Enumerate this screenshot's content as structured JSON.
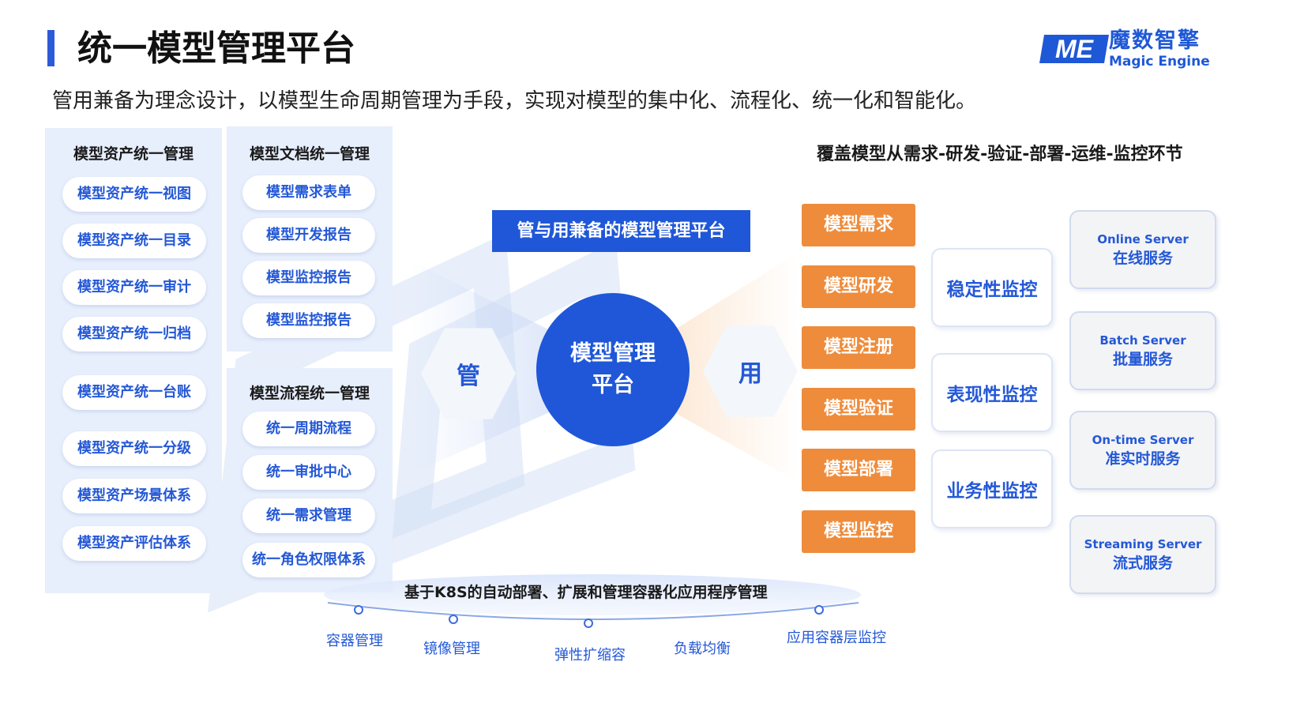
{
  "header": {
    "title": "统一模型管理平台",
    "subtitle": "管用兼备为理念设计，以模型生命周期管理为手段，实现对模型的集中化、流程化、统一化和智能化。"
  },
  "logo": {
    "mark": "ME",
    "name_cn": "魔数智擎",
    "name_en": "Magic Engine"
  },
  "asset_panel": {
    "title": "模型资产统一管理",
    "items": [
      "模型资产统一视图",
      "模型资产统一目录",
      "模型资产统一审计",
      "模型资产统一归档",
      "模型资产统一台账",
      "模型资产统一分级",
      "模型资产场景体系",
      "模型资产评估体系"
    ]
  },
  "doc_panel": {
    "title": "模型文档统一管理",
    "items": [
      "模型需求表单",
      "模型开发报告",
      "模型监控报告",
      "模型监控报告"
    ]
  },
  "flow_panel": {
    "title": "模型流程统一管理",
    "items": [
      "统一周期流程",
      "统一审批中心",
      "统一需求管理",
      "统一角色权限体系"
    ]
  },
  "center": {
    "banner": "管与用兼备的模型管理平台",
    "circle_line1": "模型管理",
    "circle_line2": "平台",
    "left_hex": "管",
    "right_hex": "用"
  },
  "right": {
    "heading": "覆盖模型从需求-研发-验证-部署-运维-监控环节",
    "stages": [
      "模型需求",
      "模型研发",
      "模型注册",
      "模型验证",
      "模型部署",
      "模型监控"
    ],
    "monitors": [
      "稳定性监控",
      "表现性监控",
      "业务性监控"
    ],
    "servers": [
      {
        "en": "Online Server",
        "cn": "在线服务"
      },
      {
        "en": "Batch Server",
        "cn": "批量服务"
      },
      {
        "en": "On-time Server",
        "cn": "准实时服务"
      },
      {
        "en": "Streaming Server",
        "cn": "流式服务"
      }
    ]
  },
  "k8s": {
    "title": "基于K8S的自动部署、扩展和管理容器化应用程序管理",
    "items": [
      "容器管理",
      "镜像管理",
      "弹性扩缩容",
      "负载均衡",
      "应用容器层监控"
    ]
  },
  "colors": {
    "accent_blue": "#1f57d8",
    "orange": "#ee8c3c",
    "panel_bg": "#e7eefc"
  }
}
